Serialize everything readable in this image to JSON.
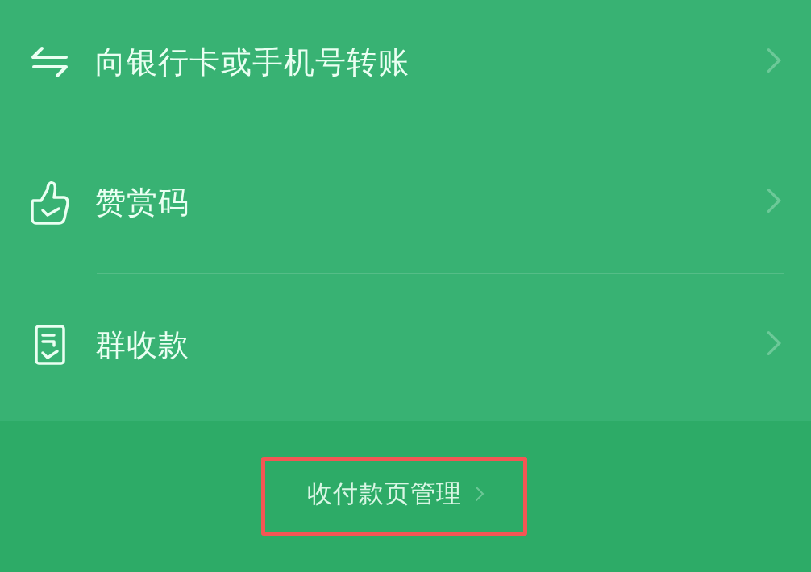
{
  "menu": [
    {
      "kind": "transfer",
      "label": "向银行卡或手机号转账"
    },
    {
      "kind": "reward",
      "label": "赞赏码"
    },
    {
      "kind": "group",
      "label": "群收款"
    }
  ],
  "footer_link": {
    "label": "收付款页管理",
    "highlighted": true
  }
}
